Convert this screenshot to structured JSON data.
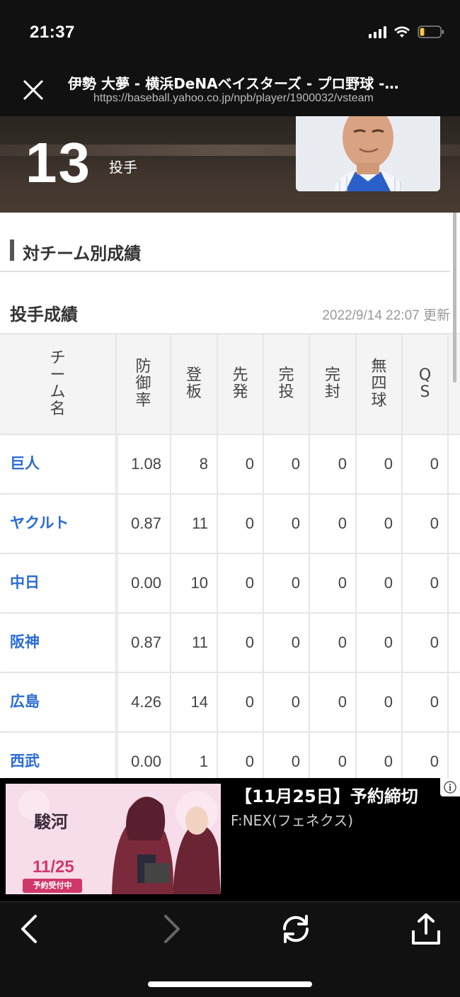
{
  "status_bar": {
    "time": "21:37"
  },
  "browser": {
    "title": "伊勢 大夢 - 横浜DeNAベイスターズ - プロ野球 -…",
    "url": "https://baseball.yahoo.co.jp/npb/player/1900032/vsteam"
  },
  "player": {
    "number": "13",
    "position": "投手"
  },
  "section": {
    "title": "対チーム別成績"
  },
  "stats": {
    "title": "投手成績",
    "updated": "2022/9/14 22:07 更新",
    "columns": [
      "チーム名",
      "防御率",
      "登板",
      "先発",
      "完投",
      "完封",
      "無四球",
      "QS"
    ],
    "rows": [
      {
        "team": "巨人",
        "values": [
          "1.08",
          "8",
          "0",
          "0",
          "0",
          "0",
          "0"
        ]
      },
      {
        "team": "ヤクルト",
        "values": [
          "0.87",
          "11",
          "0",
          "0",
          "0",
          "0",
          "0"
        ]
      },
      {
        "team": "中日",
        "values": [
          "0.00",
          "10",
          "0",
          "0",
          "0",
          "0",
          "0"
        ]
      },
      {
        "team": "阪神",
        "values": [
          "0.87",
          "11",
          "0",
          "0",
          "0",
          "0",
          "0"
        ]
      },
      {
        "team": "広島",
        "values": [
          "4.26",
          "14",
          "0",
          "0",
          "0",
          "0",
          "0"
        ]
      },
      {
        "team": "西武",
        "values": [
          "0.00",
          "1",
          "0",
          "0",
          "0",
          "0",
          "0"
        ]
      }
    ]
  },
  "ad": {
    "title": "【11月25日】予約締切",
    "advertiser": "F:NEX(フェネクス)",
    "image_text": {
      "name": "駿河",
      "date": "11/25",
      "cta": "予約受付中"
    }
  }
}
